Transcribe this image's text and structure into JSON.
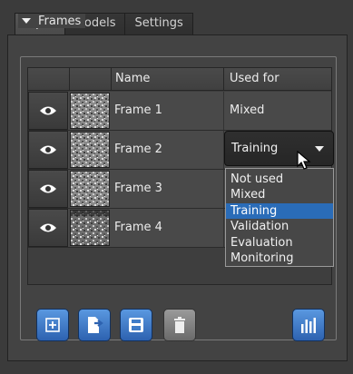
{
  "tabs": [
    {
      "label": "Input",
      "active": true
    },
    {
      "label": "Models",
      "active": false
    },
    {
      "label": "Settings",
      "active": false
    }
  ],
  "group": {
    "title": "Frames"
  },
  "table": {
    "headers": [
      "Name",
      "Used for"
    ],
    "rows": [
      {
        "name": "Frame 1",
        "used_for": "Mixed"
      },
      {
        "name": "Frame 2",
        "used_for": "Training"
      },
      {
        "name": "Frame 3",
        "used_for": ""
      },
      {
        "name": "Frame 4",
        "used_for": ""
      }
    ]
  },
  "combo": {
    "value": "Training",
    "options": [
      "Not used",
      "Mixed",
      "Training",
      "Validation",
      "Evaluation",
      "Monitoring"
    ],
    "selected_index": 2
  },
  "toolbar": {
    "icons": [
      "add-frame-icon",
      "import-icon",
      "save-icon",
      "delete-icon",
      "statistics-icon"
    ]
  },
  "colors": {
    "accent": "#2a6cb8",
    "button_blue": "#3f7cc8",
    "button_gray": "#7d7d7d",
    "panel": "#434343"
  }
}
